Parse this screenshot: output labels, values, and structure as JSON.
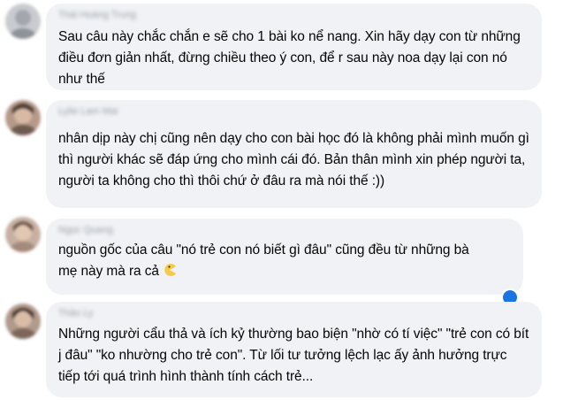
{
  "comments": [
    {
      "author": "Thái Hoàng Trung",
      "text": "Sau câu này chắc chắn e sẽ cho 1 bài ko nể nang. Xin hãy dạy con từ những điều đơn giản nhất, đừng chiều theo ý con, để r sau này noa dạy lại con nó như thế"
    },
    {
      "author": "Lylie Lam Mai",
      "text": "nhân dịp này chị cũng nên dạy cho con bài học đó là không phải mình muốn gì thì người khác sẽ đáp ứng cho mình cái đó. Bản thân mình xin phép người ta, người ta không cho thì thôi chứ ở đâu ra mà nói thế :))"
    },
    {
      "author": "Ngọc Quang",
      "text": "nguồn gốc của câu \"nó trẻ con nó biết gì đâu\" cũng đều từ những bà mẹ này mà ra cả",
      "emoji": "pacman-emoji"
    },
    {
      "author": "Thảo Ly",
      "text": "Những người cẩu thả và ích kỷ thường bao biện \"nhờ có tí việc\" \"trẻ con có bít j đâu\" \"ko nhường cho trẻ con\". Từ lối tư tưởng lệch lạc ấy ảnh hưởng trực tiếp tới quá trình hình thành tính cách trẻ..."
    }
  ],
  "colors": {
    "bubble": "#f0f2f5",
    "text": "#050505",
    "reaction": "#1b74e4"
  }
}
